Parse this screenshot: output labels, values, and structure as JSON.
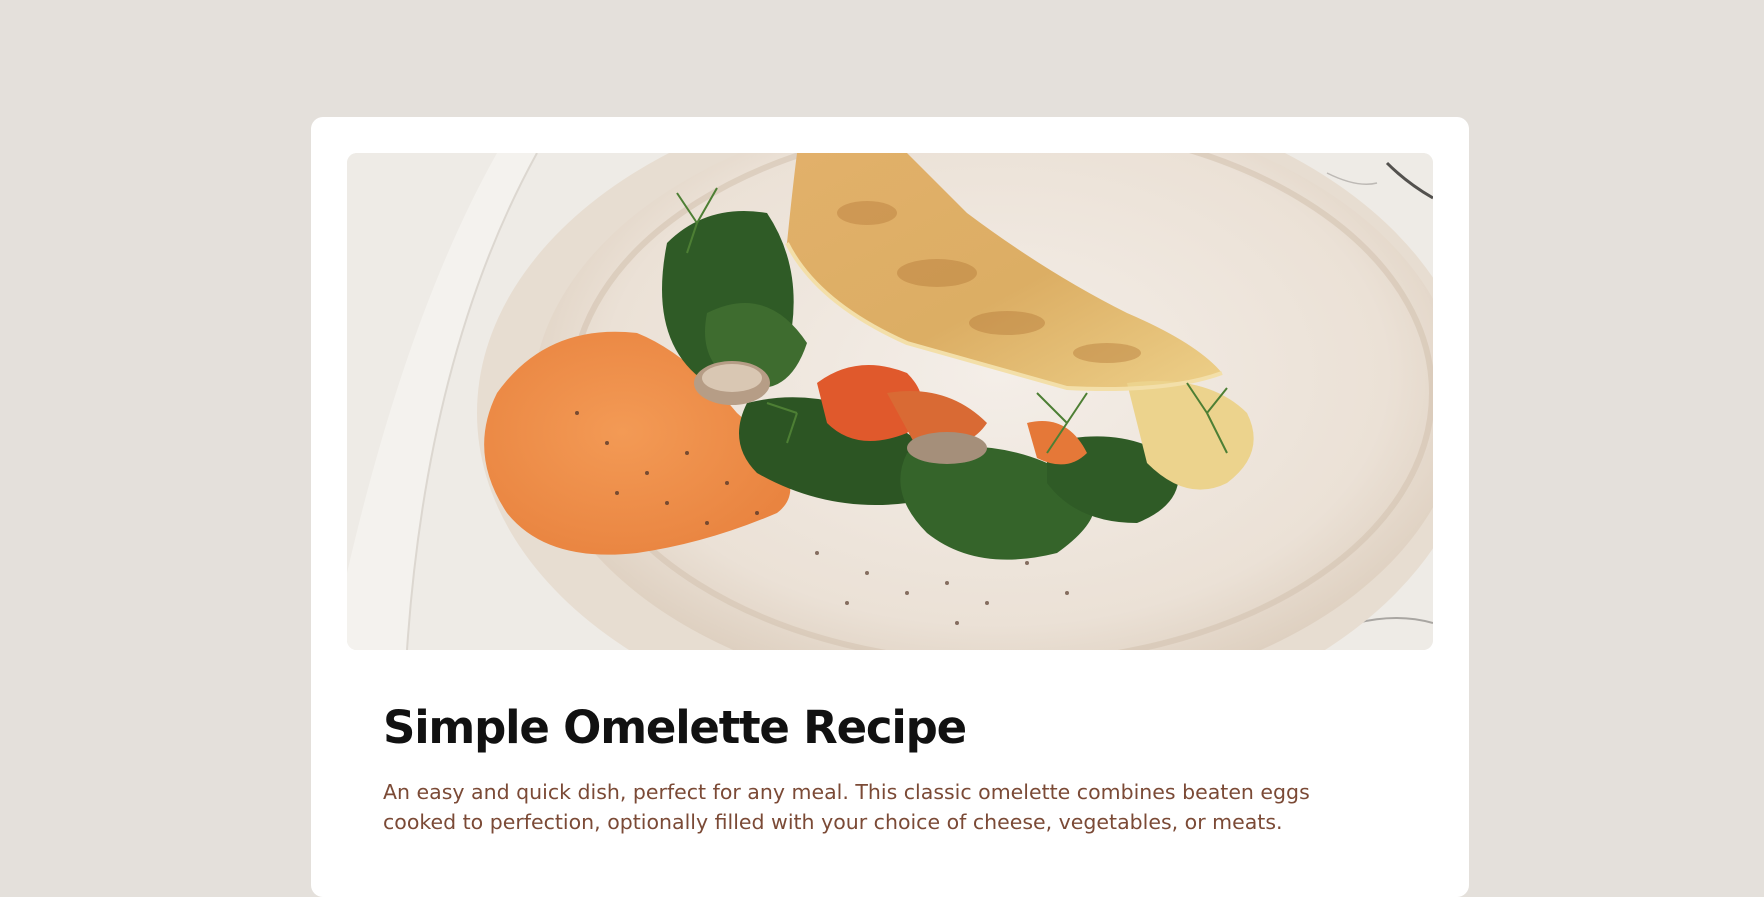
{
  "recipe": {
    "title": "Simple Omelette Recipe",
    "description": "An easy and quick dish, perfect for any meal. This classic omelette combines beaten eggs cooked to perfection, optionally filled with your choice of cheese, vegetables, or meats.",
    "hero_image_alt": "Omelette with spinach, dill and hummus on a ceramic plate"
  },
  "colors": {
    "page_background": "#e4e0db",
    "card_background": "#ffffff",
    "title": "#111111",
    "description": "#7b4a36"
  }
}
